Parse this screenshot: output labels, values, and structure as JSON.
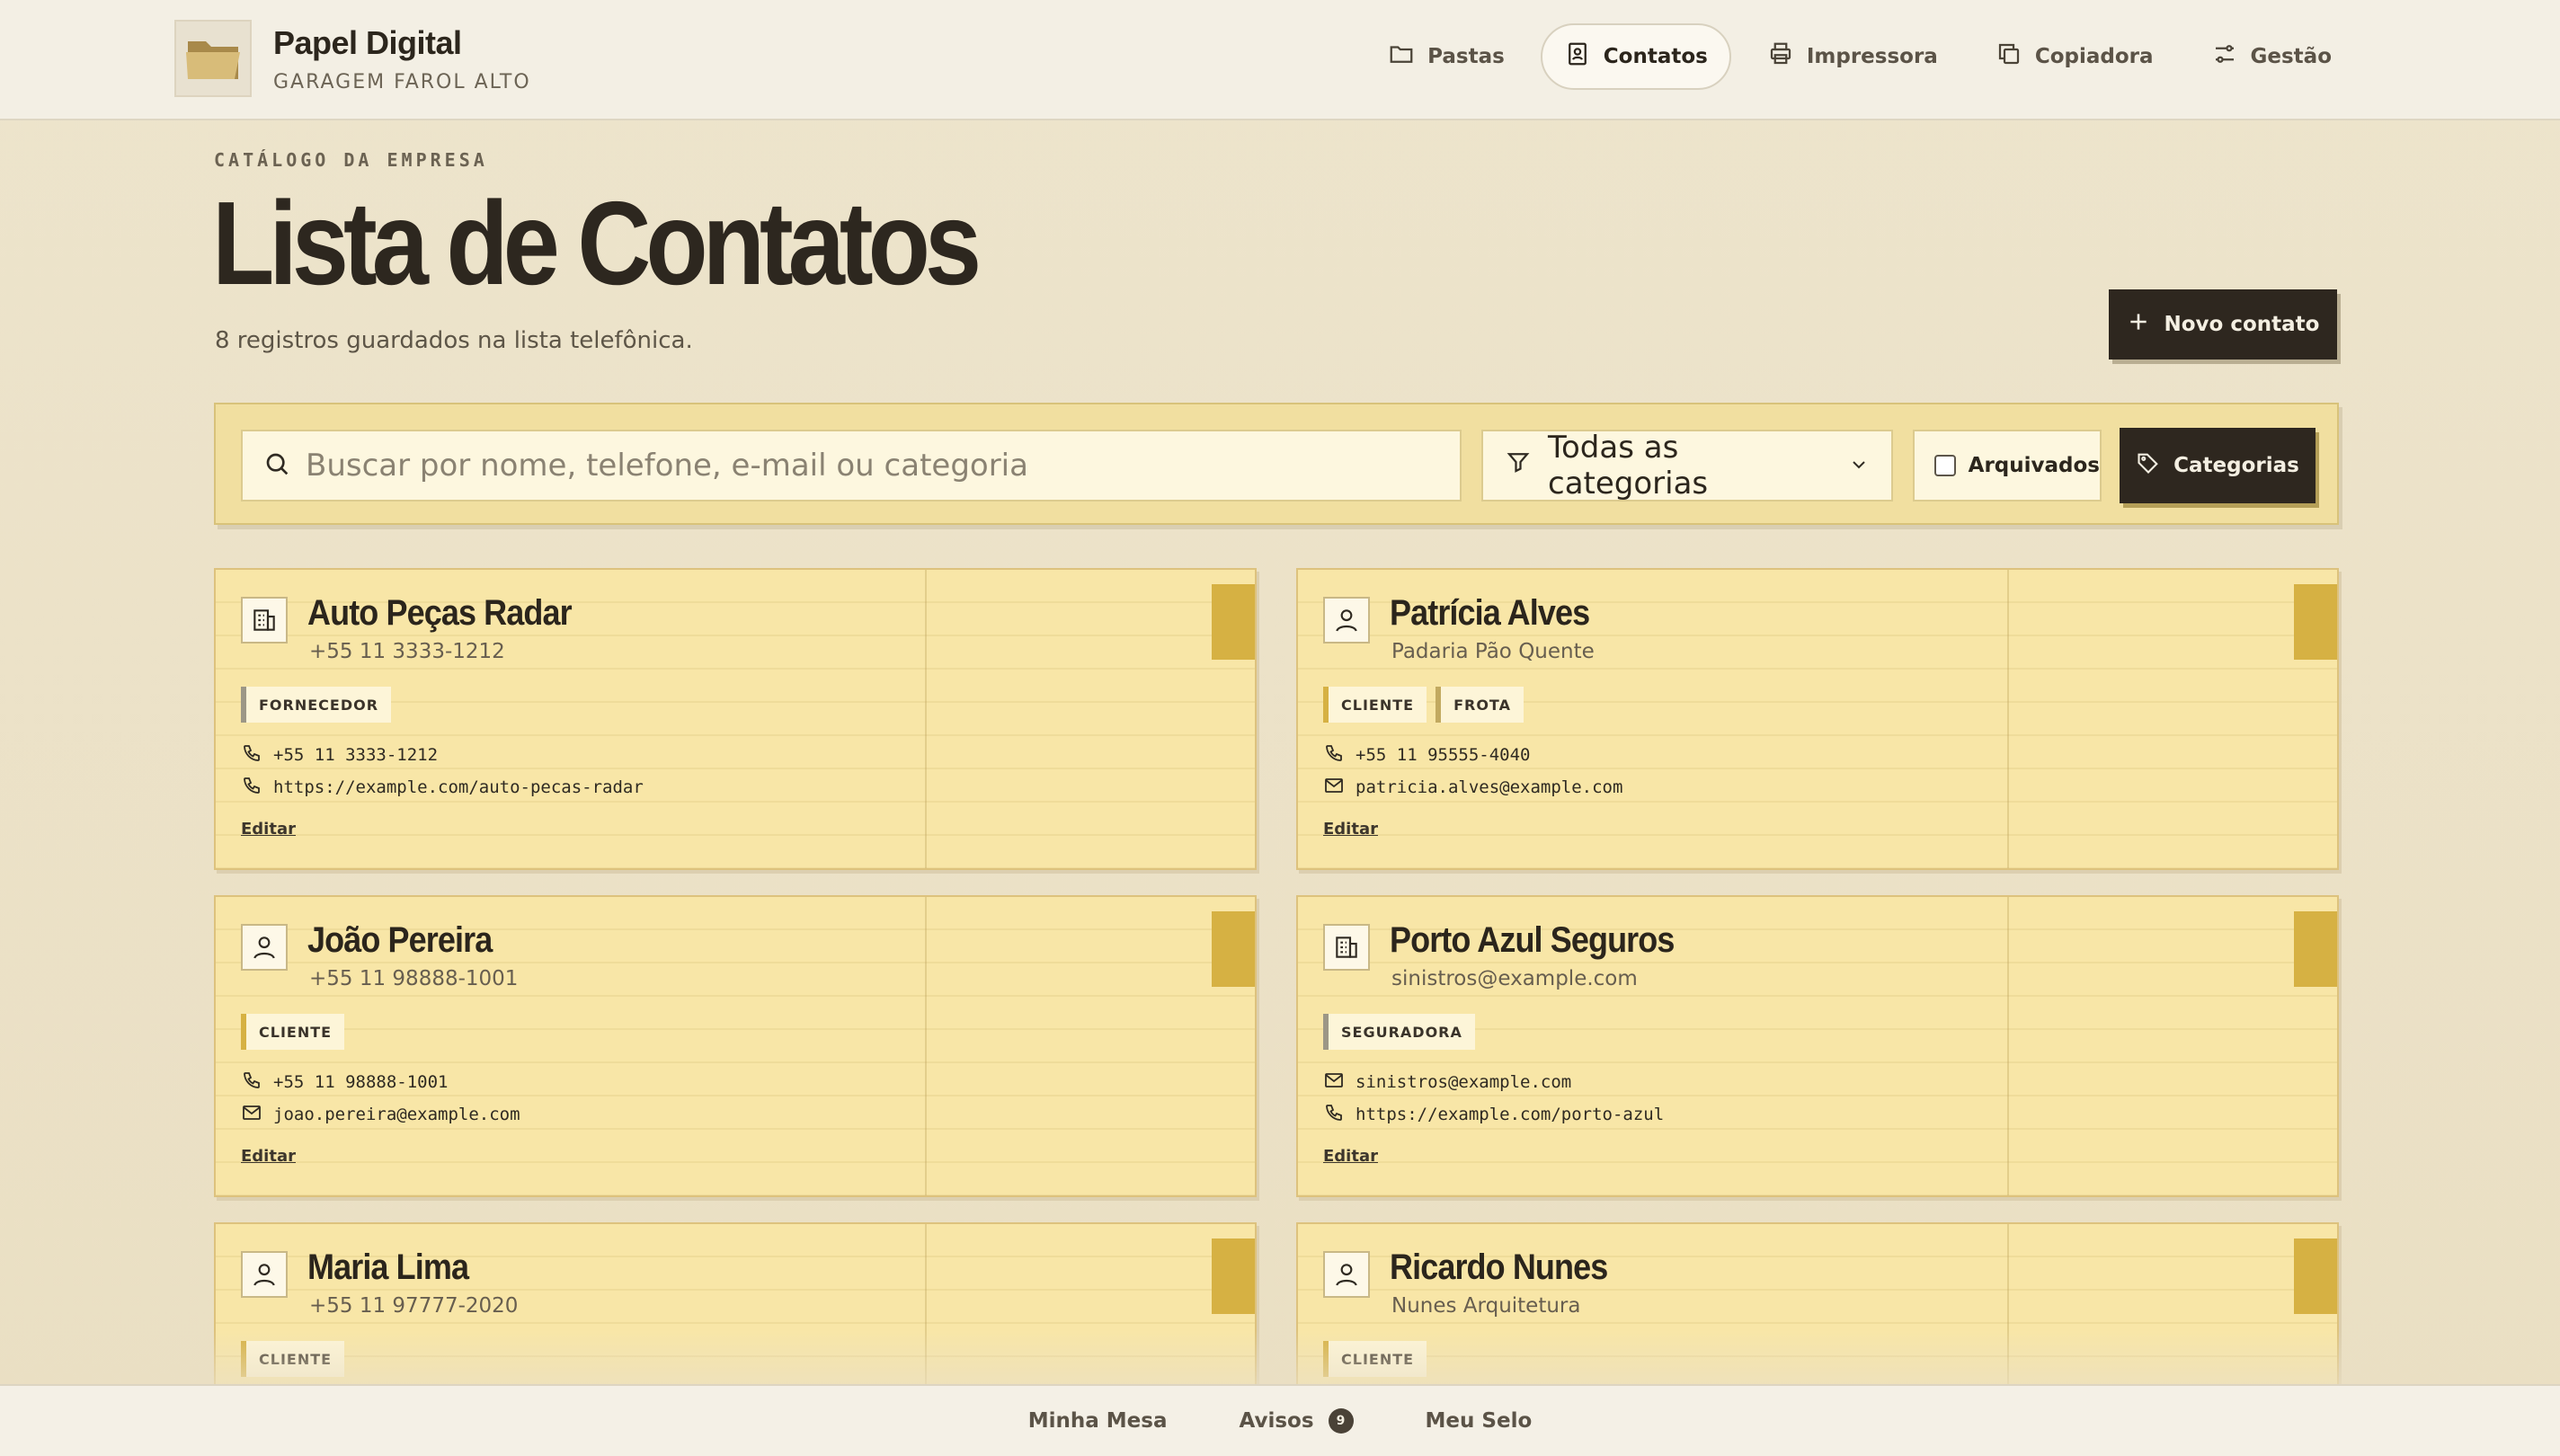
{
  "brand": {
    "title": "Papel Digital",
    "subtitle": "GARAGEM FAROL ALTO",
    "logo_icon": "folder-icon"
  },
  "nav": {
    "items": [
      {
        "label": "Pastas",
        "icon": "folder-icon",
        "active": false
      },
      {
        "label": "Contatos",
        "icon": "contact-book-icon",
        "active": true
      },
      {
        "label": "Impressora",
        "icon": "printer-icon",
        "active": false
      },
      {
        "label": "Copiadora",
        "icon": "copy-icon",
        "active": false
      },
      {
        "label": "Gestão",
        "icon": "sliders-icon",
        "active": false
      }
    ]
  },
  "hero": {
    "eyebrow": "CATÁLOGO DA EMPRESA",
    "title": "Lista de Contatos",
    "subtitle": "8 registros guardados na lista telefônica.",
    "new_button": "Novo contato"
  },
  "filters": {
    "search_placeholder": "Buscar por nome, telefone, e-mail ou categoria",
    "search_value": "",
    "category_select": "Todas as categorias",
    "archived_label": "Arquivados",
    "archived_checked": false,
    "categories_button": "Categorias"
  },
  "contacts": [
    {
      "name": "Auto Peças Radar",
      "sub": "+55 11 3333-1212",
      "type": "company",
      "tags": [
        "FORNECEDOR"
      ],
      "lines": [
        {
          "icon": "phone-icon",
          "text": "+55 11 3333-1212"
        },
        {
          "icon": "phone-icon",
          "text": "https://example.com/auto-pecas-radar"
        }
      ],
      "edit": "Editar"
    },
    {
      "name": "Patrícia Alves",
      "sub": "Padaria Pão Quente",
      "type": "person",
      "tags": [
        "CLIENTE",
        "FROTA"
      ],
      "lines": [
        {
          "icon": "phone-icon",
          "text": "+55 11 95555-4040"
        },
        {
          "icon": "mail-icon",
          "text": "patricia.alves@example.com"
        }
      ],
      "edit": "Editar"
    },
    {
      "name": "João Pereira",
      "sub": "+55 11 98888-1001",
      "type": "person",
      "tags": [
        "CLIENTE"
      ],
      "lines": [
        {
          "icon": "phone-icon",
          "text": "+55 11 98888-1001"
        },
        {
          "icon": "mail-icon",
          "text": "joao.pereira@example.com"
        }
      ],
      "edit": "Editar"
    },
    {
      "name": "Porto Azul Seguros",
      "sub": "sinistros@example.com",
      "type": "company",
      "tags": [
        "SEGURADORA"
      ],
      "lines": [
        {
          "icon": "mail-icon",
          "text": "sinistros@example.com"
        },
        {
          "icon": "phone-icon",
          "text": "https://example.com/porto-azul"
        }
      ],
      "edit": "Editar"
    },
    {
      "name": "Maria Lima",
      "sub": "+55 11 97777-2020",
      "type": "person",
      "tags": [
        "CLIENTE"
      ],
      "lines": [],
      "edit": ""
    },
    {
      "name": "Ricardo Nunes",
      "sub": "Nunes Arquitetura",
      "type": "person",
      "tags": [
        "CLIENTE"
      ],
      "lines": [],
      "edit": ""
    }
  ],
  "bottom": {
    "items": [
      {
        "label": "Minha Mesa"
      },
      {
        "label": "Avisos",
        "badge": "9"
      },
      {
        "label": "Meu Selo"
      }
    ]
  }
}
